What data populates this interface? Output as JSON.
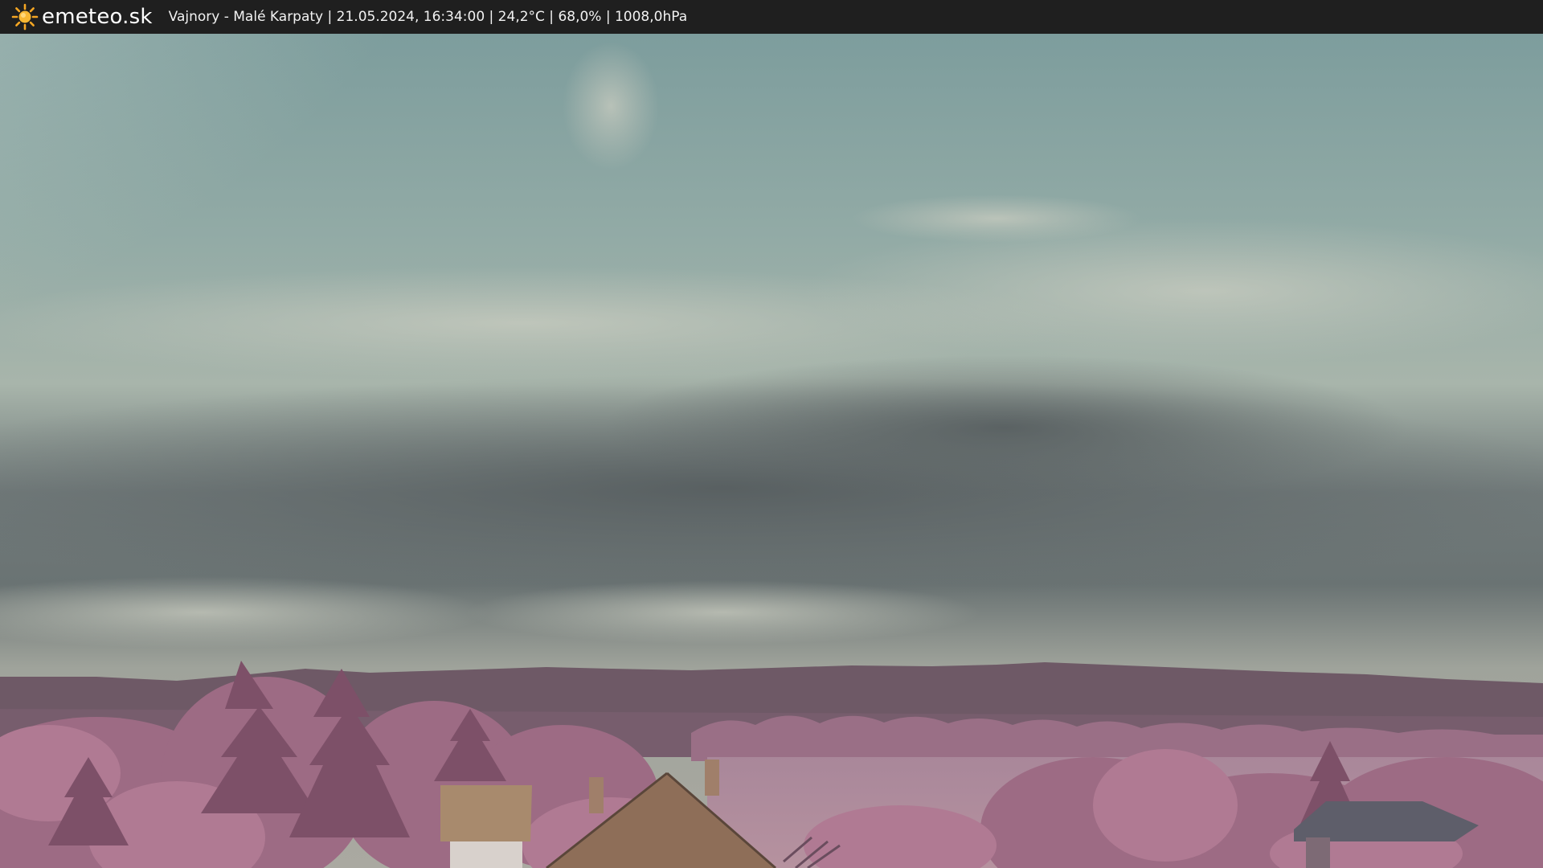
{
  "header": {
    "logo_icon": "sun-icon",
    "brand": "emeteo.sk",
    "caption": "Vajnory - Malé Karpaty | 21.05.2024, 16:34:00 | 24,2°C | 68,0% | 1008,0hPa"
  },
  "colors": {
    "bar_bg": "#1f1f1f",
    "sun": "#f5a623",
    "sky_top": "#7e9e9c",
    "cloud_dark": "#5e6466",
    "foliage": "#a56f89",
    "hills": "#6f5a66"
  }
}
